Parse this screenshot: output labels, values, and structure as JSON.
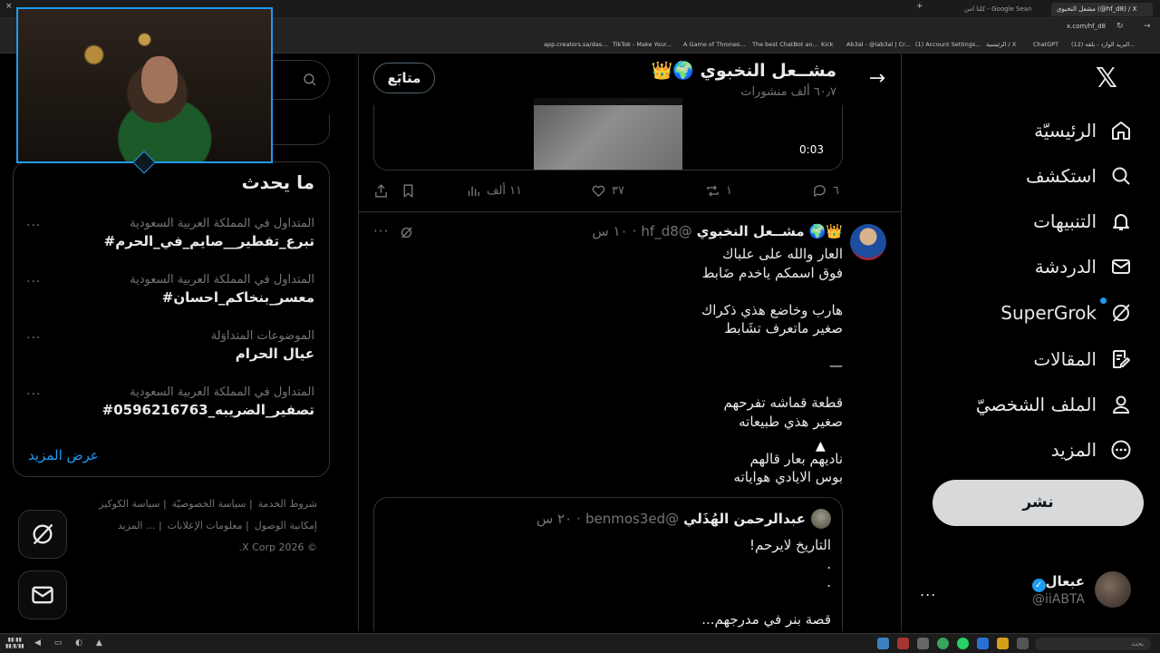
{
  "browser": {
    "tabs": [
      {
        "label": "مشعل النخبوي (@hf_d8) / X",
        "active": true
      },
      {
        "label": "كلنا امن - Google Search",
        "active": false
      },
      {
        "label": "Google Search",
        "active": false
      }
    ],
    "url": "x.com/hf_d8",
    "bookmarks": [
      "app.creators.sa/das...",
      "TikTok - Make Your...",
      "A Game of Thrones...",
      "The best ChatBot an...",
      "Kick",
      "Ab3al - @iab3al | Cr...",
      "(1) Account Settings...",
      "الرئيسية / X",
      "ChatGPT",
      "(12) البريد الوارد - بلقه..."
    ]
  },
  "nav": {
    "items": [
      {
        "label": "الرئيسيّة",
        "icon": "home-icon"
      },
      {
        "label": "استكشف",
        "icon": "search-icon"
      },
      {
        "label": "التنبيهات",
        "icon": "bell-icon"
      },
      {
        "label": "الدردشة",
        "icon": "mail-icon"
      },
      {
        "label": "SuperGrok",
        "icon": "grok-icon"
      },
      {
        "label": "المقالات",
        "icon": "article-icon"
      },
      {
        "label": "الملف الشخصيّ",
        "icon": "profile-icon"
      },
      {
        "label": "المزيد",
        "icon": "more-circle-icon"
      }
    ],
    "post_label": "نشر",
    "account": {
      "name": "عبعال",
      "handle": "@iiABTA",
      "more": "..."
    }
  },
  "profile": {
    "name": "مشــعل النخبوي",
    "emoji": "👑🌍",
    "posts_count": "٦٠٫٧ ألف منشورات",
    "follow_label": "متابَع"
  },
  "video": {
    "duration": "0:03"
  },
  "actions_top": {
    "replies": "٦",
    "reposts": "١",
    "likes": "٣٧",
    "views": "١١ ألف"
  },
  "tweet": {
    "name": "مشــعل النخبوي",
    "emoji": "👑🌍",
    "handle": "@hf_d8",
    "time": "١٠ س",
    "lines": [
      "العار والله على علباك",
      "فوق اسمكم ياخدم ضَابط",
      "",
      "هارب وخاضع هذي ذكراك",
      "صغير ماتعرف تشَابط",
      "",
      "—",
      "",
      "قطعة قماشه تفرحهم",
      "صغير هذي طبيعاته",
      "",
      "ناديهم بعار قالهم",
      "بوس الايادي هواياته"
    ],
    "quote": {
      "name": "عبدالرحمن الهُذَلي",
      "handle": "@benmos3ed",
      "time": "٢٠ س",
      "lines": [
        "التاريخ لايرحم!",
        ".",
        ".",
        "",
        "قصة بنر في مدرجهم..."
      ]
    }
  },
  "trends": {
    "title": "ما يحدث",
    "items": [
      {
        "context": "المتداول في المملكة العربية السعودية",
        "name": "#تبرع_تفطير__صايم_في_الحرم"
      },
      {
        "context": "المتداول في المملكة العربية السعودية",
        "name": "#معسر_بنخاكم_احسان"
      },
      {
        "context": "الموضوعات المتداوَلة",
        "name": "عيال الحرام"
      },
      {
        "context": "المتداول في المملكة العربية السعودية",
        "name": "#تصفير_الضريبه_0596216763"
      }
    ],
    "show_more": "عرض المزيد"
  },
  "footer": {
    "links": [
      "شروط الخدمة",
      "سياسة الخصوصيّة",
      "سياسة الكوكيز",
      "إمكانية الوصول",
      "معلومات الإعلانات",
      "... المزيد"
    ],
    "copyright": "© 2026 X Corp."
  },
  "taskbar": {
    "search_placeholder": "بحث"
  },
  "colors": {
    "accent": "#1d9bf0",
    "border": "#2f3336",
    "muted": "#71767b",
    "text": "#e7e9ea"
  }
}
